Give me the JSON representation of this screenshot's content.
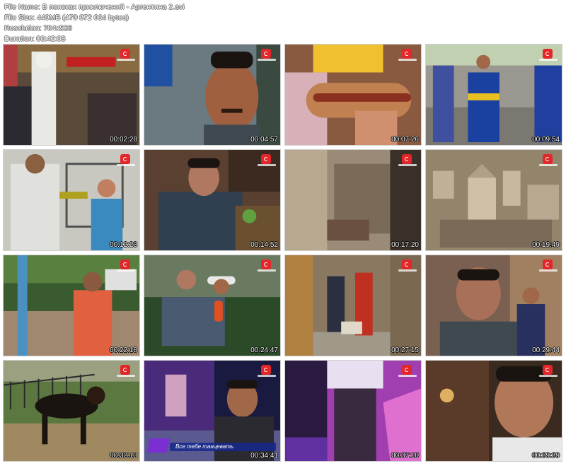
{
  "file_info": {
    "file_name": "File Name: В поисках приключений - Аргентина 2.avi",
    "file_size": "File Size: 449MB (470 872 064 bytes)",
    "resolution": "Resolution: 704x528",
    "duration": "Duration: 00:42:08"
  },
  "thumbnails": [
    {
      "time": "00:02:28"
    },
    {
      "time": "00:04:57"
    },
    {
      "time": "00:07:26"
    },
    {
      "time": "00:09:54"
    },
    {
      "time": "00:12:23"
    },
    {
      "time": "00:14:52"
    },
    {
      "time": "00:17:20"
    },
    {
      "time": "00:19:49"
    },
    {
      "time": "00:22:18"
    },
    {
      "time": "00:24:47"
    },
    {
      "time": "00:27:15"
    },
    {
      "time": "00:29:44"
    },
    {
      "time": "00:32:13"
    },
    {
      "time": "00:34:41",
      "caption": "Все тебе танцевать"
    },
    {
      "time": "00:37:10"
    },
    {
      "time": "00:39:39"
    }
  ],
  "colors": {
    "channel_logo": "#e3262a",
    "caption_bar": "#14288c"
  }
}
